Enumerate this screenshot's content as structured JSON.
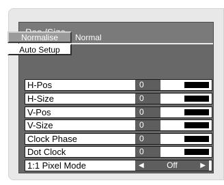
{
  "menu": {
    "title": "Pos./Size",
    "normalise_label": "Normalise",
    "normalise_value": "Normal",
    "auto_setup_label": "Auto Setup",
    "rows": [
      {
        "label": "H-Pos",
        "value": "0"
      },
      {
        "label": "H-Size",
        "value": "0"
      },
      {
        "label": "V-Pos",
        "value": "0"
      },
      {
        "label": "V-Size",
        "value": "0"
      },
      {
        "label": "Clock Phase",
        "value": "0"
      },
      {
        "label": "Dot Clock",
        "value": "0"
      }
    ],
    "pixel_mode": {
      "label": "1:1 Pixel Mode",
      "value": "Off"
    }
  },
  "colors": {
    "menu_background": "#686868",
    "header_background": "#7a7a7a",
    "value_box": "#5e5e5e"
  }
}
